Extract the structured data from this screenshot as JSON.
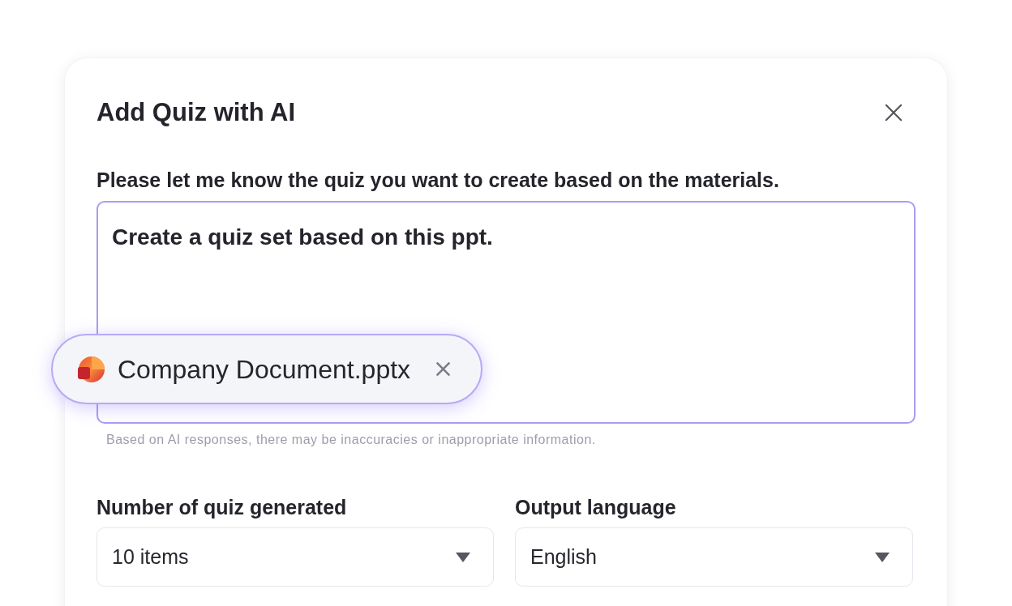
{
  "dialog": {
    "title": "Add Quiz with AI"
  },
  "prompt": {
    "label": "Please let me know the quiz you want to create based on the materials.",
    "value": "Create a quiz set based on this ppt."
  },
  "attachment": {
    "file_name": "Company Document.pptx"
  },
  "disclaimer": "Based on AI responses, there may be inaccuracies or inappropriate information.",
  "fields": [
    {
      "label": "Number of quiz generated",
      "value": "10 items"
    },
    {
      "label": "Output language",
      "value": "English"
    }
  ]
}
